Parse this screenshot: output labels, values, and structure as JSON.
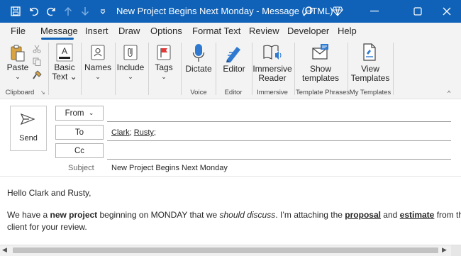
{
  "window": {
    "title": "New Project Begins Next Monday  -  Message (HTML)"
  },
  "menu": [
    "File",
    "Message",
    "Insert",
    "Draw",
    "Options",
    "Format Text",
    "Review",
    "Developer",
    "Help"
  ],
  "ribbon": {
    "paste": "Paste",
    "basic_text": "Basic",
    "basic_text2": "Text",
    "names": "Names",
    "include": "Include",
    "tags": "Tags",
    "dictate": "Dictate",
    "editor": "Editor",
    "immersive1": "Immersive",
    "immersive2": "Reader",
    "show_templates1": "Show",
    "show_templates2": "templates",
    "view_templates1": "View",
    "view_templates2": "Templates",
    "groups": {
      "clipboard": "Clipboard",
      "voice": "Voice",
      "editor": "Editor",
      "immersive": "Immersive",
      "template_phrases": "Template Phrases",
      "my_templates": "My Templates"
    }
  },
  "compose": {
    "send": "Send",
    "from": "From",
    "to": "To",
    "cc": "Cc",
    "subject_label": "Subject",
    "recipient1": "Clark",
    "recipient_sep": ";",
    "recipient2": "Rusty",
    "recipient_end": ";",
    "subject": "New Project Begins Next Monday"
  },
  "body": {
    "greeting": "Hello Clark and Rusty,",
    "l1_a": "We have a ",
    "l1_b": "new project",
    "l1_c": " beginning on MONDAY that we ",
    "l1_d": "should discuss",
    "l1_e": ". I’m attaching the ",
    "l1_f": "proposal",
    "l1_g": " and ",
    "l1_h": "estimate",
    "l1_i": " from the",
    "line2": "client for your review."
  },
  "colors": {
    "titlebar": "#0f62b8",
    "ribbon": "#f3f3f3",
    "accent": "#0f62b8"
  }
}
